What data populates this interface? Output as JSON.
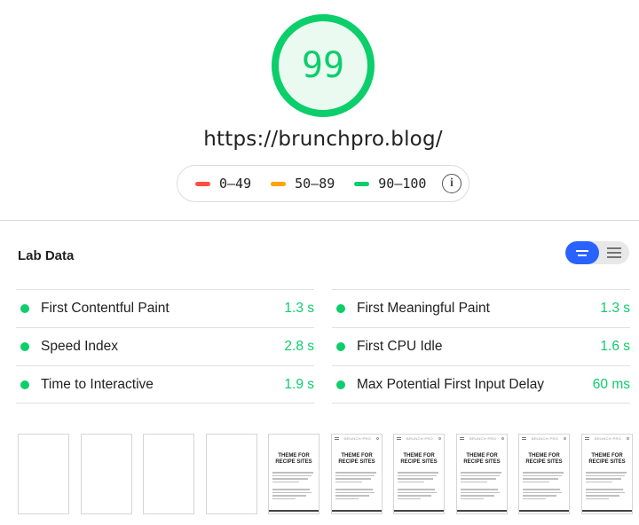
{
  "score": {
    "value": "99",
    "fraction": 0.99,
    "color": "#0cce6b",
    "track_color": "#d4f4e2"
  },
  "url": "https://brunchpro.blog/",
  "legend": {
    "items": [
      {
        "label": "0–49",
        "color": "#ff4e42"
      },
      {
        "label": "50–89",
        "color": "#ffa400"
      },
      {
        "label": "90–100",
        "color": "#0cce6b"
      }
    ],
    "info_icon": "info-icon"
  },
  "section": {
    "title": "Lab Data",
    "toggle": {
      "active": "expanded-view",
      "inactive": "list-view",
      "accent": "#2962ff"
    }
  },
  "metrics": [
    {
      "label": "First Contentful Paint",
      "value": "1.3 s",
      "status": "pass"
    },
    {
      "label": "First Meaningful Paint",
      "value": "1.3 s",
      "status": "pass"
    },
    {
      "label": "Speed Index",
      "value": "2.8 s",
      "status": "pass"
    },
    {
      "label": "First CPU Idle",
      "value": "1.6 s",
      "status": "pass"
    },
    {
      "label": "Time to Interactive",
      "value": "1.9 s",
      "status": "pass"
    },
    {
      "label": "Max Potential First Input Delay",
      "value": "60 ms",
      "status": "pass"
    }
  ],
  "filmstrip": {
    "frames": [
      {
        "state": "blank"
      },
      {
        "state": "blank"
      },
      {
        "state": "blank"
      },
      {
        "state": "blank"
      },
      {
        "state": "partial",
        "title_lines": [
          "THEME FOR",
          "RECIPE SITES"
        ]
      },
      {
        "state": "loaded",
        "brand": "BRUNCH·PRO",
        "title_lines": [
          "THEME FOR",
          "RECIPE SITES"
        ]
      },
      {
        "state": "loaded",
        "brand": "BRUNCH·PRO",
        "title_lines": [
          "THEME FOR",
          "RECIPE SITES"
        ]
      },
      {
        "state": "loaded",
        "brand": "BRUNCH·PRO",
        "title_lines": [
          "THEME FOR",
          "RECIPE SITES"
        ]
      },
      {
        "state": "loaded",
        "brand": "BRUNCH·PRO",
        "title_lines": [
          "THEME FOR",
          "RECIPE SITES"
        ]
      },
      {
        "state": "loaded",
        "brand": "BRUNCH·PRO",
        "title_lines": [
          "THEME FOR",
          "RECIPE SITES"
        ]
      }
    ]
  }
}
